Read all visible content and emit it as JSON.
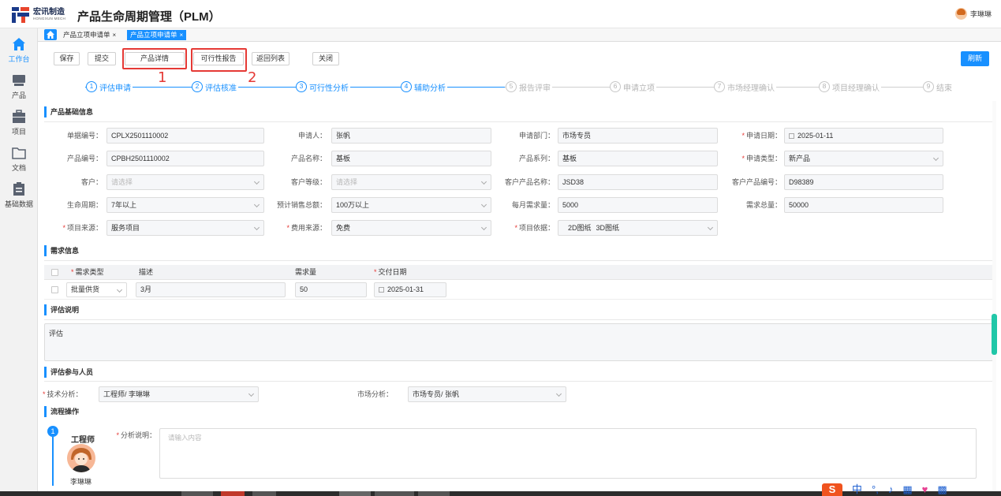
{
  "header": {
    "brand_cn": "宏讯制造",
    "brand_en": "HONGXUN MECH",
    "app_title": "产品生命周期管理（PLM）",
    "user_name": "李琳琳"
  },
  "sidebar": {
    "items": [
      {
        "label": "工作台",
        "icon": "home-icon"
      },
      {
        "label": "产品",
        "icon": "product-icon"
      },
      {
        "label": "项目",
        "icon": "briefcase-icon"
      },
      {
        "label": "文档",
        "icon": "folder-icon"
      },
      {
        "label": "基础数据",
        "icon": "clipboard-icon"
      }
    ]
  },
  "tabs": [
    {
      "label": "产品立项申请单",
      "close": "×"
    },
    {
      "label": "产品立项申请单",
      "close": "×"
    }
  ],
  "toolbar": {
    "save": "保存",
    "submit": "提交",
    "product_detail": "产品详情",
    "feasibility_report": "可行性报告",
    "back_to_list": "返回列表",
    "close": "关闭",
    "refresh": "刷新"
  },
  "annotations": [
    "1",
    "2"
  ],
  "steps": [
    {
      "num": "1",
      "label": "评估申请",
      "state": "done"
    },
    {
      "num": "2",
      "label": "评估核准",
      "state": "done"
    },
    {
      "num": "3",
      "label": "可行性分析",
      "state": "done"
    },
    {
      "num": "4",
      "label": "辅助分析",
      "state": "done"
    },
    {
      "num": "5",
      "label": "报告评审",
      "state": "todo"
    },
    {
      "num": "6",
      "label": "申请立项",
      "state": "todo"
    },
    {
      "num": "7",
      "label": "市场经理确认",
      "state": "todo"
    },
    {
      "num": "8",
      "label": "项目经理确认",
      "state": "todo"
    },
    {
      "num": "9",
      "label": "结束",
      "state": "todo"
    }
  ],
  "basic": {
    "title": "产品基础信息",
    "doc_no_label": "单据编号：",
    "doc_no": "CPLX2501110002",
    "applicant_label": "申请人：",
    "applicant": "张帆",
    "dept_label": "申请部门：",
    "dept": "市场专员",
    "apply_date_label": "申请日期：",
    "apply_date": "2025-01-11",
    "product_no_label": "产品编号：",
    "product_no": "CPBH2501110002",
    "product_name_label": "产品名称：",
    "product_name": "基板",
    "product_series_label": "产品系列：",
    "product_series": "基板",
    "apply_type_label": "申请类型：",
    "apply_type": "新产品",
    "customer_label": "客户：",
    "customer_ph": "请选择",
    "customer_level_label": "客户等级：",
    "customer_level_ph": "请选择",
    "cust_product_name_label": "客户产品名称：",
    "cust_product_name": "JSD38",
    "cust_product_no_label": "客户产品编号：",
    "cust_product_no": "D98389",
    "lifecycle_label": "生命周期：",
    "lifecycle": "7年以上",
    "sales_total_label": "预计销售总额：",
    "sales_total": "100万以上",
    "monthly_demand_label": "每月需求量：",
    "monthly_demand": "5000",
    "total_demand_label": "需求总量：",
    "total_demand": "50000",
    "project_source_label": "项目来源：",
    "project_source": "服务项目",
    "fee_source_label": "费用来源：",
    "fee_source": "免费",
    "project_basis_label": "项目依据：",
    "project_basis_tags": [
      "2D图纸",
      "3D图纸"
    ]
  },
  "demand": {
    "title": "需求信息",
    "headers": {
      "type": "需求类型",
      "desc": "描述",
      "qty": "需求量",
      "date": "交付日期"
    },
    "row": {
      "type": "批量供货",
      "desc": "3月",
      "qty": "50",
      "date": "2025-01-31"
    }
  },
  "evaluation": {
    "title": "评估说明",
    "text": "评估"
  },
  "participants": {
    "title": "评估参与人员",
    "tech_label": "技术分析：",
    "tech": "工程师/ 李琳琳",
    "market_label": "市场分析：",
    "market": "市场专员/ 张帆"
  },
  "flow": {
    "title": "流程操作",
    "step_no": "1",
    "role": "工程师",
    "person": "李琳琳",
    "analysis_label": "分析说明：",
    "analysis_ph": "请输入内容"
  },
  "ime": {
    "s": "S",
    "lang": "中"
  }
}
